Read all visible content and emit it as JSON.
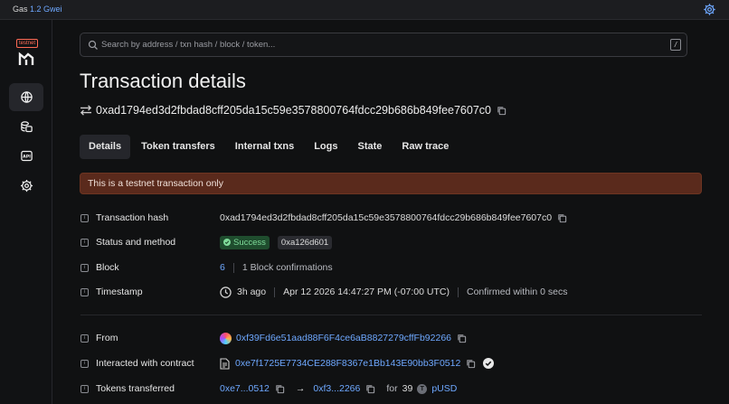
{
  "topbar": {
    "gas_label": "Gas",
    "gas_value": "1.2 Gwei"
  },
  "sidebar": {
    "badge": "testnet"
  },
  "search": {
    "placeholder": "Search by address / txn hash / block / token...",
    "shortcut": "/"
  },
  "page": {
    "title": "Transaction details",
    "hash": "0xad1794ed3d2fbdad8cff205da15c59e3578800764fdcc29b686b849fee7607c0"
  },
  "tabs": [
    {
      "label": "Details"
    },
    {
      "label": "Token transfers"
    },
    {
      "label": "Internal txns"
    },
    {
      "label": "Logs"
    },
    {
      "label": "State"
    },
    {
      "label": "Raw trace"
    }
  ],
  "alert": "This is a testnet transaction only",
  "details": {
    "tx_hash": {
      "label": "Transaction hash",
      "value": "0xad1794ed3d2fbdad8cff205da15c59e3578800764fdcc29b686b849fee7607c0"
    },
    "status": {
      "label": "Status and method",
      "status": "Success",
      "method": "0xa126d601"
    },
    "block": {
      "label": "Block",
      "number": "6",
      "confirmations": "1 Block confirmations"
    },
    "timestamp": {
      "label": "Timestamp",
      "ago": "3h ago",
      "date": "Apr 12 2026 14:47:27 PM (-07:00 UTC)",
      "confirmed": "Confirmed within 0 secs"
    },
    "from": {
      "label": "From",
      "address": "0xf39Fd6e51aad88F6F4ce6aB8827279cffFb92266"
    },
    "contract": {
      "label": "Interacted with contract",
      "address": "0xe7f1725E7734CE288F8367e1Bb143E90bb3F0512"
    },
    "tokens": {
      "label": "Tokens transferred",
      "from": "0xe7...0512",
      "arrow": "→",
      "to": "0xf3...2266",
      "for": "for",
      "amount": "39",
      "symbol": "pUSD",
      "token_letter": "T"
    }
  },
  "colors": {
    "accent": "#6ea8ff",
    "success": "#7fdc9a",
    "alert_bg": "#5a2a1c"
  }
}
